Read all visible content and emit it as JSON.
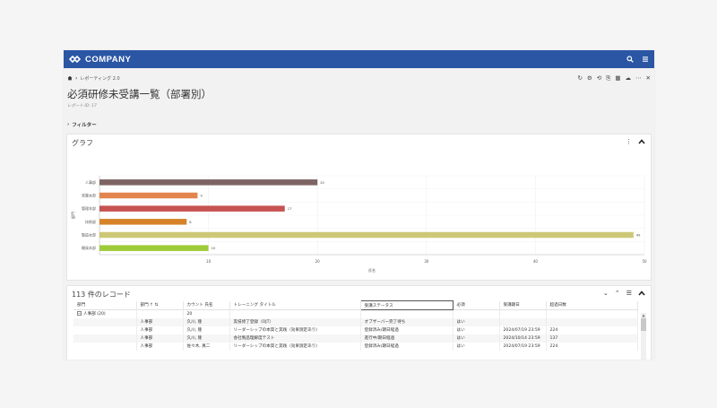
{
  "app": {
    "brand": "COMPANY",
    "icons": [
      "search-icon",
      "menu-icon"
    ]
  },
  "breadcrumb": {
    "home_icon": "home-icon",
    "items": [
      "レポーティング 2.0"
    ]
  },
  "toolbar_icons": [
    "refresh-icon",
    "gear-icon",
    "history-icon",
    "export-icon",
    "excel-icon",
    "cloud-icon",
    "more-icon",
    "close-icon"
  ],
  "page": {
    "title": "必須研修未受講一覧（部署別）",
    "report_id": "レポート ID: 17",
    "filter_label": "フィルター"
  },
  "graph_panel": {
    "title": "グラフ"
  },
  "chart_data": {
    "type": "bar",
    "orientation": "horizontal",
    "categories": [
      "人事部",
      "営業本部",
      "管理本部",
      "技術部",
      "製造本部",
      "開発本部"
    ],
    "values": [
      20,
      9,
      17,
      8,
      49,
      10
    ],
    "xlabel": "氏名",
    "ylabel": "部門",
    "xlim": [
      0,
      50
    ],
    "xticks": [
      10,
      20,
      30,
      40,
      50
    ],
    "colors": [
      "#7d6364",
      "#e3854e",
      "#c75252",
      "#d6832a",
      "#ccc877",
      "#9ecb3a"
    ],
    "grid": true
  },
  "records": {
    "title": "113 件のレコード",
    "columns": [
      "部門",
      "部門 ↑ ⇅",
      "カウント 氏名",
      "トレーニング タイトル",
      "受講ステータス",
      "必須",
      "受講期日",
      "超過日数"
    ],
    "group": {
      "label": "人事部 (20)",
      "count": "20"
    },
    "rows": [
      [
        "",
        "人事部",
        "久川, 隆",
        "実技修了登録（OJT）",
        "オブザーバー完了待ち",
        "はい",
        "",
        ""
      ],
      [
        "",
        "人事部",
        "久川, 隆",
        "リーダーシップの本質と実践（効果測定あり）",
        "登録済み/期日経過",
        "はい",
        "2024/07/19 23:59",
        "224"
      ],
      [
        "",
        "人事部",
        "久川, 隆",
        "会社製品理解度テスト",
        "進行中/期日経過",
        "はい",
        "2024/10/14 23:59",
        "137"
      ],
      [
        "",
        "人事部",
        "佐々木, 真二",
        "リーダーシップの本質と実践（効果測定あり）",
        "登録済み/期日経過",
        "はい",
        "2024/07/19 23:59",
        "224"
      ]
    ]
  }
}
